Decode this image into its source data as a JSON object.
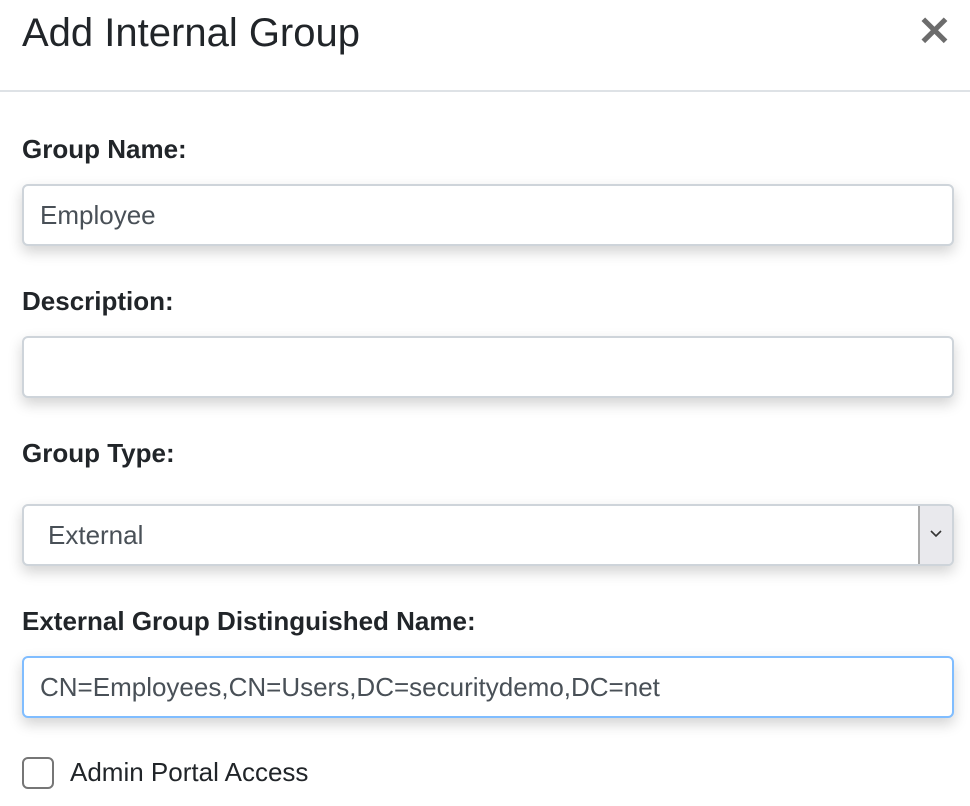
{
  "modal": {
    "title": "Add Internal Group",
    "close_label": "×"
  },
  "form": {
    "group_name": {
      "label": "Group Name:",
      "value": "Employee"
    },
    "description": {
      "label": "Description:",
      "value": ""
    },
    "group_type": {
      "label": "Group Type:",
      "selected": "External"
    },
    "external_dn": {
      "label": "External Group Distinguished Name:",
      "value": "CN=Employees,CN=Users,DC=securitydemo,DC=net"
    },
    "admin_portal_access": {
      "label": "Admin Portal Access",
      "checked": false
    }
  },
  "colors": {
    "focus_border": "#80bdff",
    "input_border": "#ced4da",
    "text": "#212529",
    "input_text": "#495057"
  },
  "icons": {
    "close": "close-icon",
    "dropdown": "chevron-down-icon"
  }
}
